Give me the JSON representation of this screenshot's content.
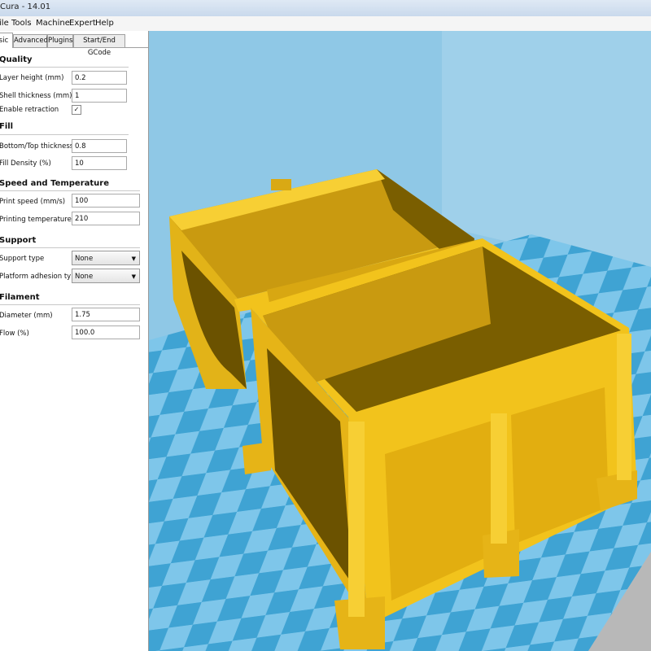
{
  "window": {
    "title": "Cura - 14.01"
  },
  "menu": [
    "File",
    "Tools",
    "Machine",
    "Expert",
    "Help"
  ],
  "tabs": [
    "Basic",
    "Advanced",
    "Plugins",
    "Start/End GCode"
  ],
  "sections": {
    "quality": {
      "title": "Quality",
      "layer_height_label": "Layer height (mm)",
      "layer_height": "0.2",
      "shell_label": "Shell thickness (mm)",
      "shell": "1",
      "retraction_label": "Enable retraction",
      "retraction": "✓"
    },
    "fill": {
      "title": "Fill",
      "bottom_top_label": "Bottom/Top thickness (mm)",
      "bottom_top": "0.8",
      "density_label": "Fill Density (%)",
      "density": "10"
    },
    "speed": {
      "title": "Speed and Temperature",
      "print_speed_label": "Print speed (mm/s)",
      "print_speed": "100",
      "temp_label": "Printing temperature (C)",
      "temp": "210"
    },
    "support": {
      "title": "Support",
      "type_label": "Support type",
      "type": "None",
      "adhesion_label": "Platform adhesion type",
      "adhesion": "None"
    },
    "filament": {
      "title": "Filament",
      "diameter_label": "Diameter (mm)",
      "diameter": "1.75",
      "flow_label": "Flow (%)",
      "flow": "100.0"
    }
  },
  "colors": {
    "model": "#f2c31c",
    "bed_a": "#3fa3d3",
    "bed_b": "#7ec6ea",
    "sky": "#8fc8e6"
  }
}
